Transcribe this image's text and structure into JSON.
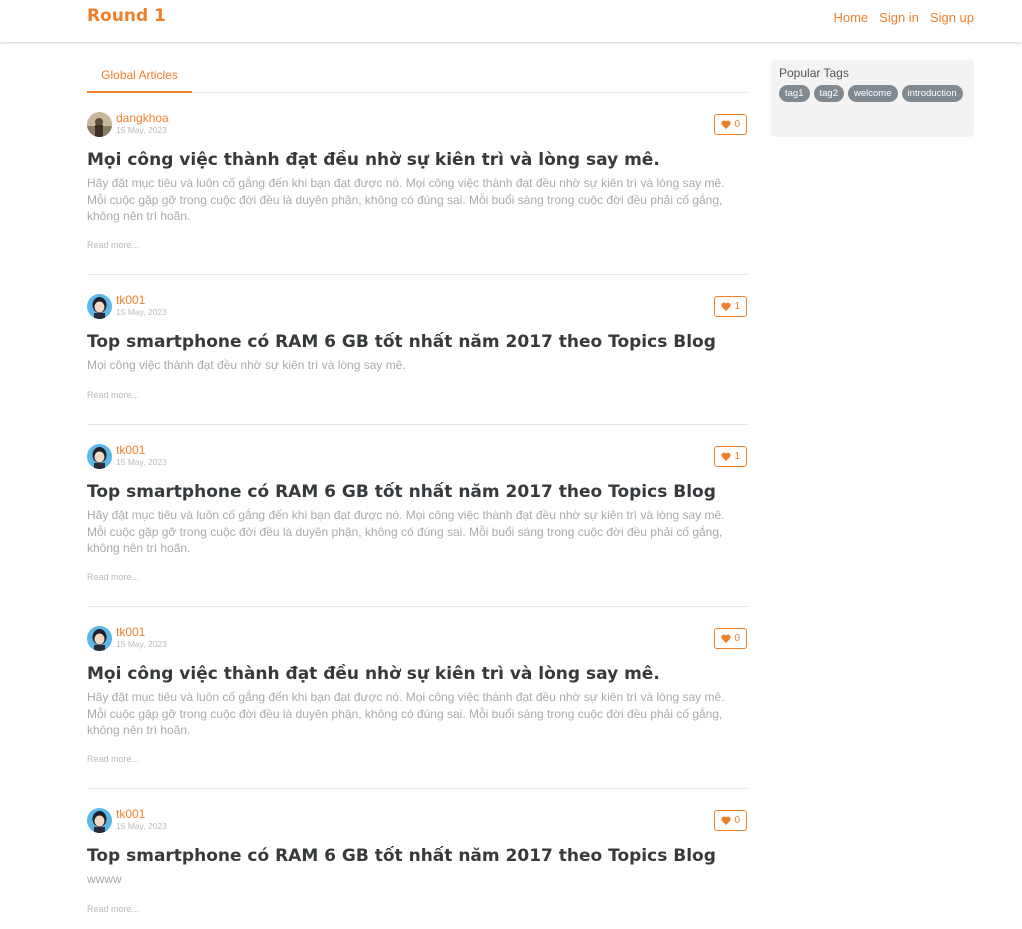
{
  "nav": {
    "brand": "Round 1",
    "links": [
      "Home",
      "Sign in",
      "Sign up"
    ]
  },
  "feed": {
    "tab_label": "Global Articles",
    "articles": [
      {
        "author": "dangkhoa",
        "date": "15 May, 2023",
        "likes": "0",
        "title": "Mọi công việc thành đạt đều nhờ sự kiên trì và lòng say mê.",
        "description": "Hãy đặt mục tiêu và luôn cố gắng đến khi bạn đạt được nó. Mọi công việc thành đạt đều nhờ sự kiên trì và lòng say mê. Mỗi cuộc gặp gỡ trong cuộc đời đều là duyên phận, không có đúng sai. Mỗi buổi sáng trong cuộc đời đều phải cố gắng, không nên trì hoãn.",
        "read_more": "Read more..."
      },
      {
        "author": "tk001",
        "date": "15 May, 2023",
        "likes": "1",
        "title": "Top smartphone có RAM 6 GB tốt nhất năm 2017 theo Topics Blog",
        "description": "Mọi công việc thành đạt đều nhờ sự kiên trì và lòng say mê.",
        "read_more": "Read more..."
      },
      {
        "author": "tk001",
        "date": "15 May, 2023",
        "likes": "1",
        "title": "Top smartphone có RAM 6 GB tốt nhất năm 2017 theo Topics Blog",
        "description": "Hãy đặt mục tiêu và luôn cố gắng đến khi bạn đạt được nó. Mọi công việc thành đạt đều nhờ sự kiên trì và lòng say mê. Mỗi cuộc gặp gỡ trong cuộc đời đều là duyên phận, không có đúng sai. Mỗi buổi sáng trong cuộc đời đều phải cố gắng, không nên trì hoãn.",
        "read_more": "Read more..."
      },
      {
        "author": "tk001",
        "date": "15 May, 2023",
        "likes": "0",
        "title": "Mọi công việc thành đạt đều nhờ sự kiên trì và lòng say mê.",
        "description": "Hãy đặt mục tiêu và luôn cố gắng đến khi bạn đạt được nó. Mọi công việc thành đạt đều nhờ sự kiên trì và lòng say mê. Mỗi cuộc gặp gỡ trong cuộc đời đều là duyên phận, không có đúng sai. Mỗi buổi sáng trong cuộc đời đều phải cố gắng, không nên trì hoãn.",
        "read_more": "Read more..."
      },
      {
        "author": "tk001",
        "date": "15 May, 2023",
        "likes": "0",
        "title": "Top smartphone có RAM 6 GB tốt nhất năm 2017 theo Topics Blog",
        "description": "wwww",
        "read_more": "Read more..."
      }
    ]
  },
  "sidebar": {
    "title": "Popular Tags",
    "tags": [
      "tag1",
      "tag2",
      "welcome",
      "introduction"
    ]
  },
  "colors": {
    "accent": "#f07f2a",
    "tag_bg": "#818a91",
    "sidebar_bg": "#f3f3f3"
  },
  "icons": {
    "like": "heart-icon",
    "avatar_1": "avatar-photo",
    "avatar_2": "avatar-cartoon"
  }
}
